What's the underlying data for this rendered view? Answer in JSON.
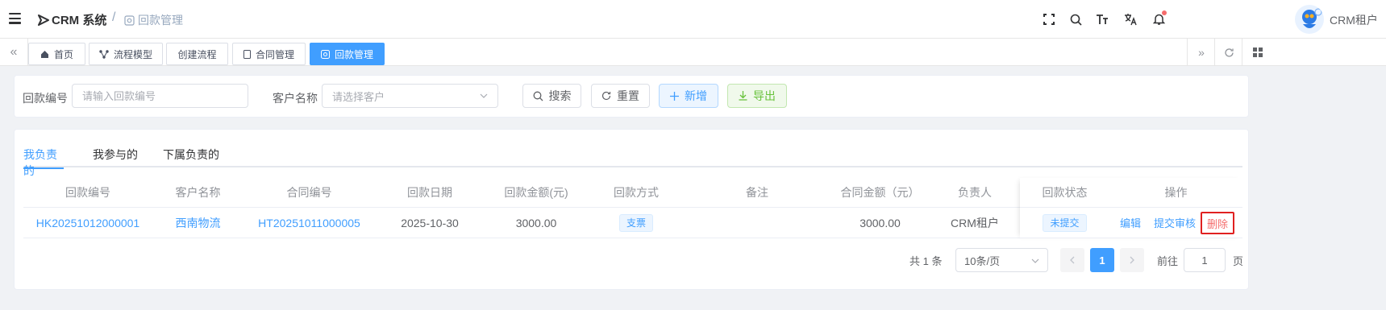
{
  "header": {
    "logo_text": "CRM 系统",
    "breadcrumb_separator": "/",
    "breadcrumb_current": "回款管理",
    "username": "CRM租户",
    "icons": [
      "fullscreen-icon",
      "search-icon",
      "font-size-icon",
      "translate-icon",
      "bell-icon"
    ]
  },
  "tags": [
    {
      "label": "首页",
      "icon": "home-icon",
      "active": false
    },
    {
      "label": "流程模型",
      "icon": "flow-icon",
      "active": false
    },
    {
      "label": "创建流程",
      "icon": "",
      "active": false
    },
    {
      "label": "合同管理",
      "icon": "document-icon",
      "active": false
    },
    {
      "label": "回款管理",
      "icon": "payment-icon",
      "active": true
    }
  ],
  "search": {
    "payment_no_label": "回款编号",
    "payment_no_placeholder": "请输入回款编号",
    "customer_label": "客户名称",
    "customer_placeholder": "请选择客户",
    "search_button": "搜索",
    "reset_button": "重置",
    "add_button": "新增",
    "export_button": "导出"
  },
  "tabs": [
    "我负责的",
    "我参与的",
    "下属负责的"
  ],
  "table": {
    "columns": [
      "回款编号",
      "客户名称",
      "合同编号",
      "回款日期",
      "回款金额(元)",
      "回款方式",
      "备注",
      "合同金额（元）",
      "负责人",
      "回款状态",
      "操作"
    ],
    "rows": [
      {
        "payment_no": "HK20251012000001",
        "customer": "西南物流",
        "contract_no": "HT20251011000005",
        "date": "2025-10-30",
        "amount": "3000.00",
        "method": "支票",
        "remark": "",
        "contract_amount": "3000.00",
        "owner": "CRM租户",
        "status": "未提交",
        "actions": [
          "编辑",
          "提交审核",
          "删除"
        ]
      }
    ]
  },
  "pagination": {
    "total": "共 1 条",
    "page_size": "10条/页",
    "current_page": "1",
    "goto_label": "前往",
    "goto_value": "1",
    "page_suffix": "页"
  },
  "colors": {
    "primary": "#409eff",
    "danger": "#f56c6c",
    "success": "#67c23a"
  }
}
